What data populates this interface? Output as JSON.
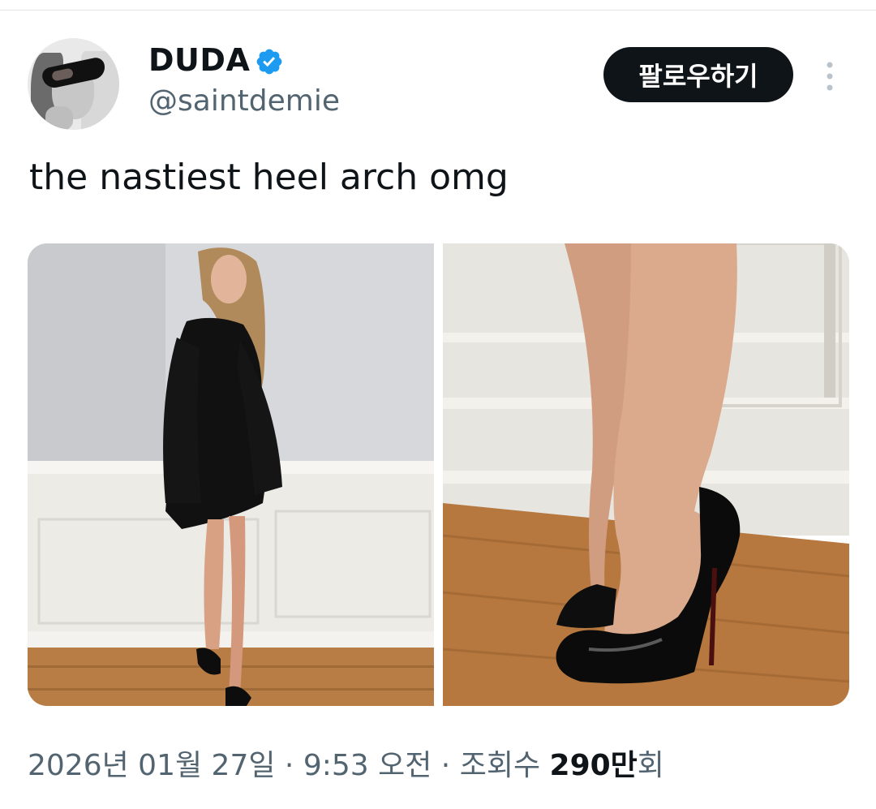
{
  "author": {
    "display_name": "DUDA",
    "handle": "@saintdemie",
    "verified_icon": "verified-badge-icon"
  },
  "actions": {
    "follow_label": "팔로우하기",
    "more_icon": "more-vertical-icon"
  },
  "tweet": {
    "text": "the nastiest heel arch omg"
  },
  "media": [
    {
      "label": "photo-1"
    },
    {
      "label": "photo-2"
    }
  ],
  "meta": {
    "date": "2026년 01월 27일",
    "sep1": " · ",
    "time": "9:53 오전",
    "sep2": " · ",
    "views_prefix": "조회수 ",
    "views_count": "290만",
    "views_suffix": "회"
  },
  "colors": {
    "accent_blue": "#1d9bf0",
    "text_primary": "#0f1419",
    "text_secondary": "#536471",
    "button_bg": "#0f1419"
  }
}
